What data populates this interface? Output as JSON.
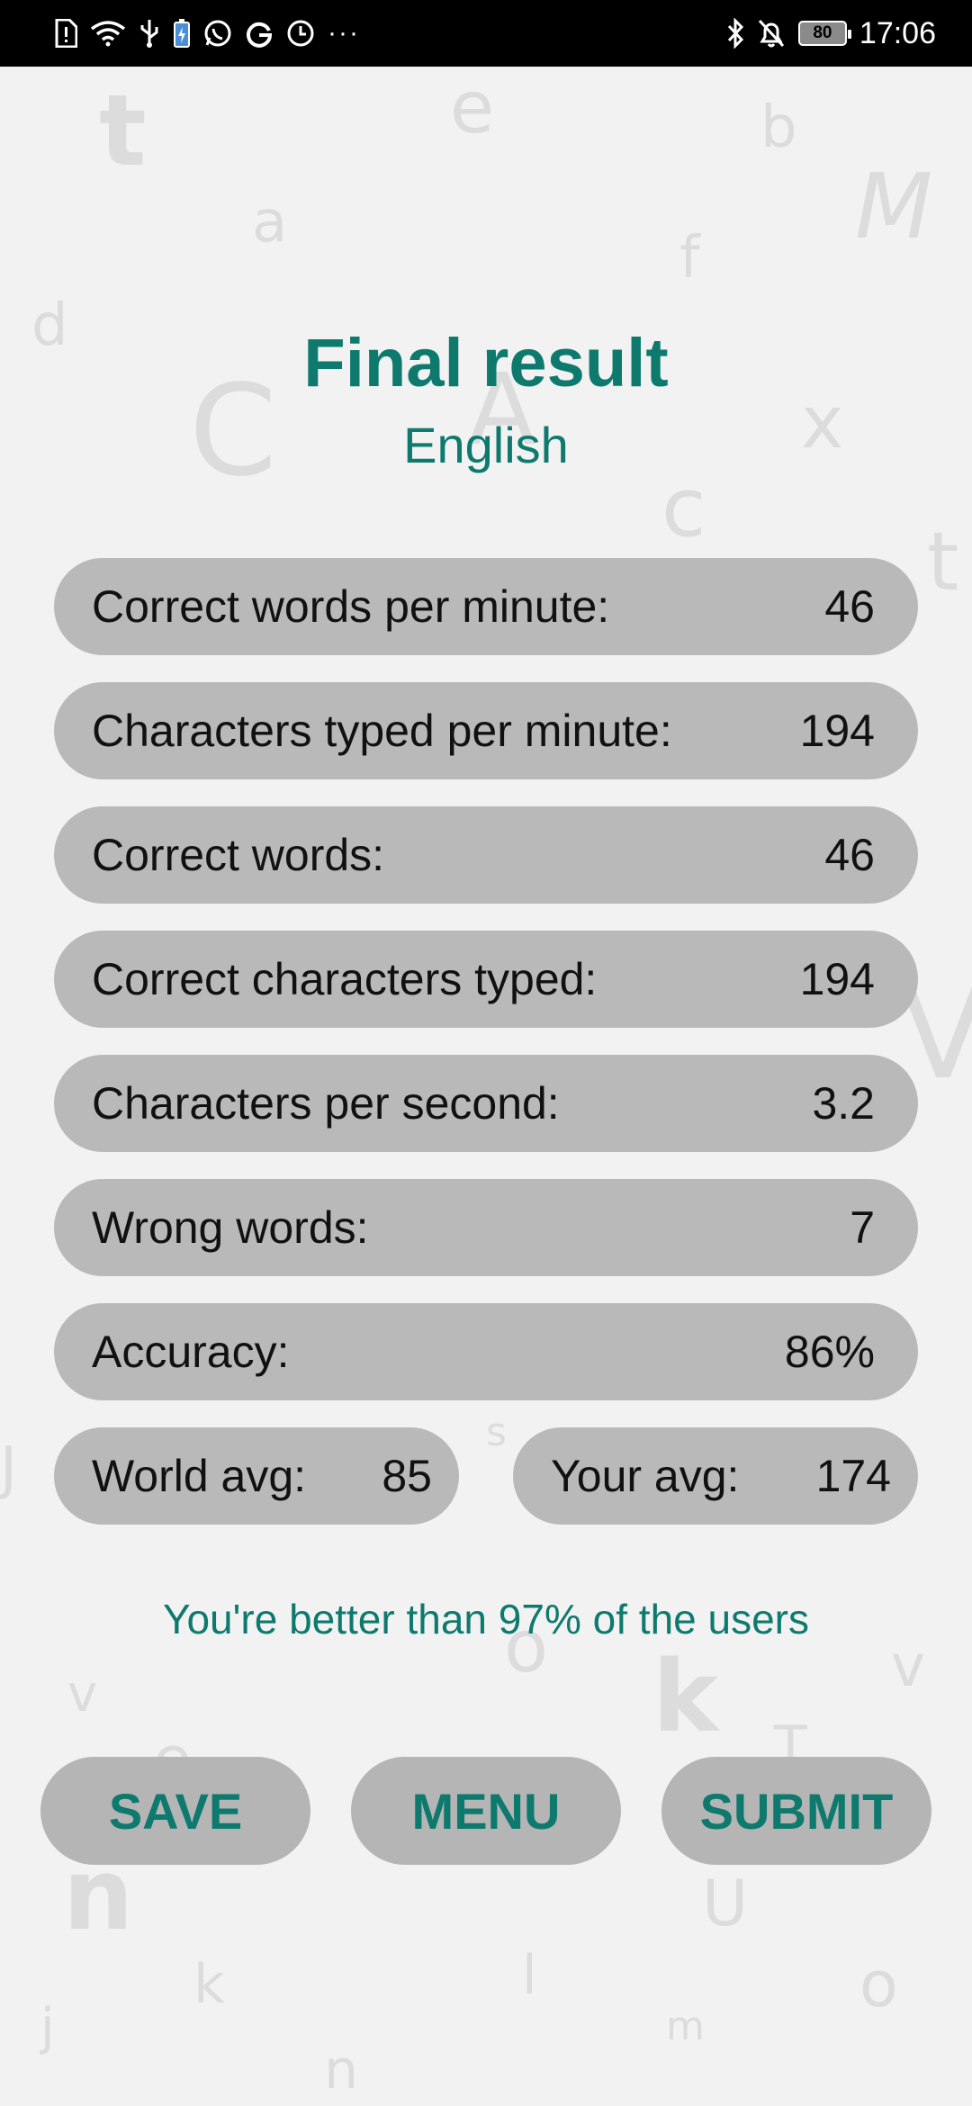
{
  "status_bar": {
    "battery": "80",
    "time": "17:06",
    "left_icons": [
      "alert-icon",
      "wifi-icon",
      "usb-icon",
      "battery-saver-icon",
      "whatsapp-icon",
      "google-icon",
      "clock-icon"
    ],
    "more": "···",
    "right_icons": [
      "bluetooth-icon",
      "mute-icon"
    ]
  },
  "header": {
    "title": "Final result",
    "language": "English"
  },
  "stats": [
    {
      "label": "Correct words per minute:",
      "value": "46"
    },
    {
      "label": "Characters typed per minute:",
      "value": "194"
    },
    {
      "label": "Correct words:",
      "value": "46"
    },
    {
      "label": "Correct characters typed:",
      "value": "194"
    },
    {
      "label": "Characters per second:",
      "value": "3.2"
    },
    {
      "label": "Wrong words:",
      "value": "7"
    },
    {
      "label": "Accuracy:",
      "value": "86%"
    }
  ],
  "averages": {
    "world_label": "World avg:",
    "world_value": "85",
    "your_label": "Your avg:",
    "your_value": "174"
  },
  "comparison_text": "You're better than 97% of the users",
  "buttons": {
    "save": "SAVE",
    "menu": "MENU",
    "submit": "SUBMIT"
  },
  "colors": {
    "accent": "#0e7a6e",
    "pill": "#b9b9b9",
    "background": "#f2f2f2"
  }
}
